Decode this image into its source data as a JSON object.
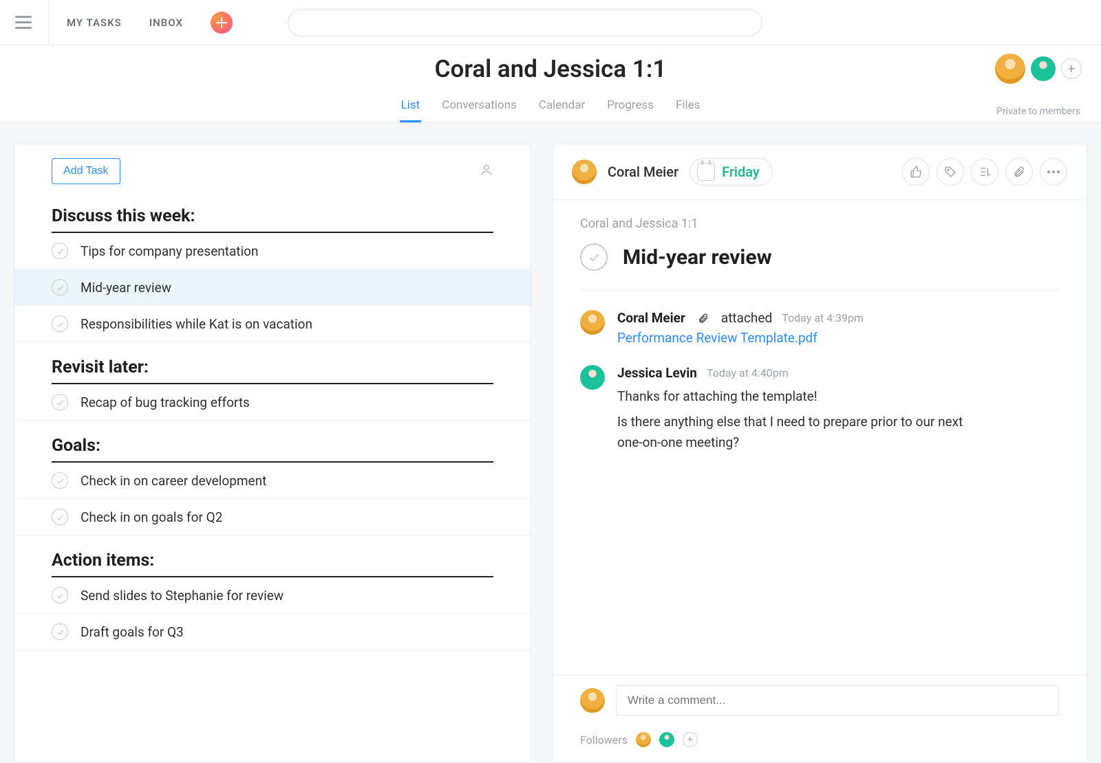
{
  "topnav": {
    "my_tasks": "MY TASKS",
    "inbox": "INBOX",
    "search_placeholder": ""
  },
  "project": {
    "title": "Coral and Jessica 1:1",
    "tabs": [
      "List",
      "Conversations",
      "Calendar",
      "Progress",
      "Files"
    ],
    "active_tab": 0,
    "privacy": "Private to members"
  },
  "taskpane": {
    "add_task": "Add Task",
    "sections": [
      {
        "title": "Discuss this week:",
        "tasks": [
          {
            "name": "Tips for company presentation",
            "selected": false
          },
          {
            "name": "Mid-year review",
            "selected": true
          },
          {
            "name": "Responsibilities while Kat is on vacation",
            "selected": false
          }
        ]
      },
      {
        "title": "Revisit later:",
        "tasks": [
          {
            "name": "Recap of bug tracking efforts",
            "selected": false
          }
        ]
      },
      {
        "title": "Goals:",
        "tasks": [
          {
            "name": "Check in on career development",
            "selected": false
          },
          {
            "name": "Check in on goals for Q2",
            "selected": false
          }
        ]
      },
      {
        "title": "Action items:",
        "tasks": [
          {
            "name": "Send slides to Stephanie for review",
            "selected": false
          },
          {
            "name": "Draft goals for Q3",
            "selected": false
          }
        ]
      }
    ]
  },
  "detail": {
    "assignee": "Coral Meier",
    "due": "Friday",
    "breadcrumb": "Coral and Jessica 1:1",
    "title": "Mid-year review",
    "comments": [
      {
        "author": "Coral Meier",
        "action": "attached",
        "time": "Today at 4:39pm",
        "attachment": "Performance Review Template.pdf",
        "avatar": "coral"
      },
      {
        "author": "Jessica Levin",
        "time": "Today at 4:40pm",
        "text1": "Thanks for attaching the template!",
        "text2": "Is there anything else that I need to prepare prior to our next one-on-one meeting?",
        "avatar": "jess"
      }
    ],
    "comment_placeholder": "Write a comment...",
    "followers_label": "Followers"
  }
}
